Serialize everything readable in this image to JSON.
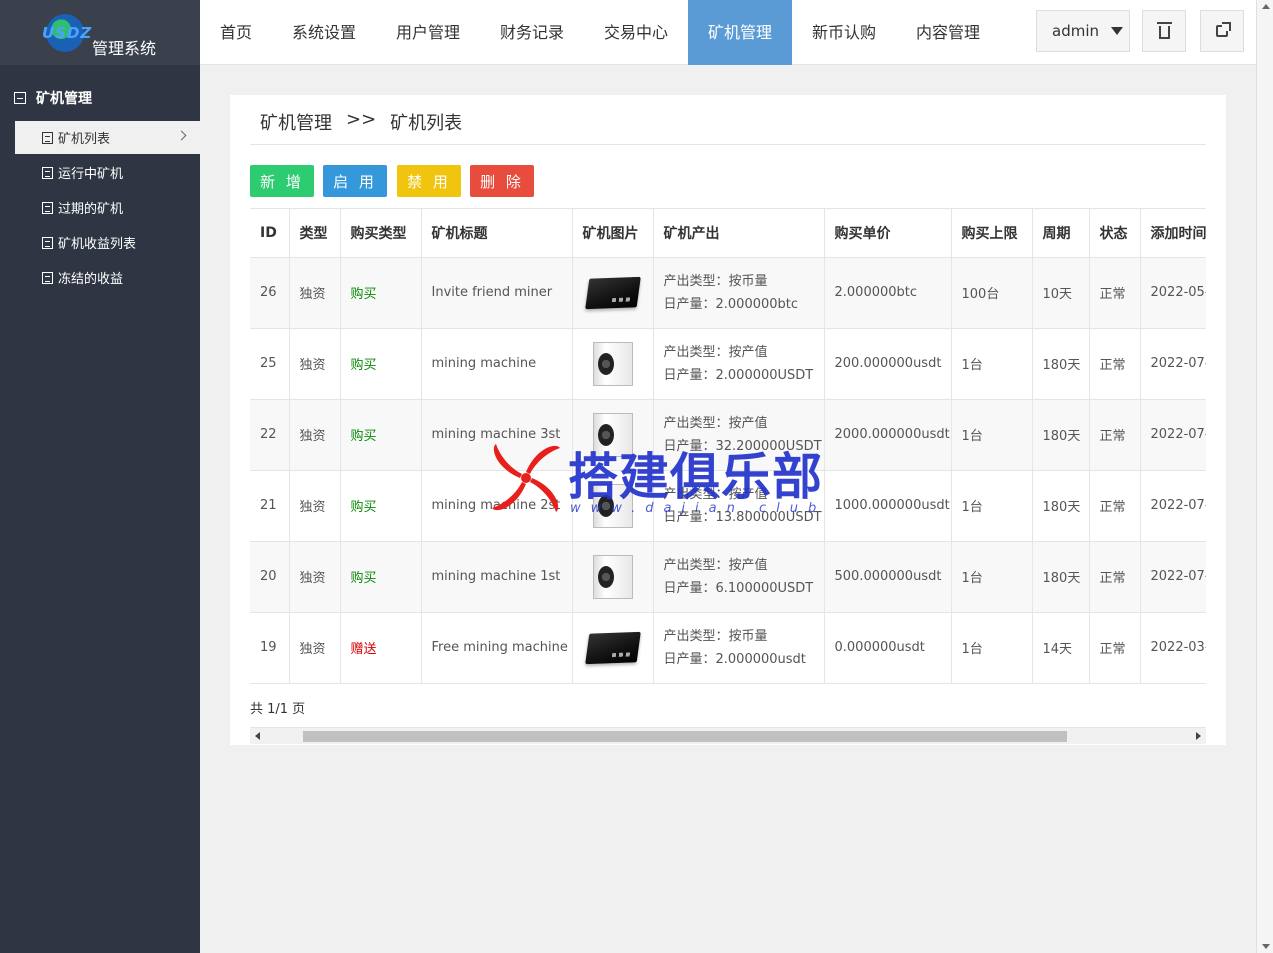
{
  "logo": {
    "brand": "USDZ",
    "system_name": "管理系统"
  },
  "sidebar": {
    "group_title": "矿机管理",
    "items": [
      {
        "label": "矿机列表",
        "active": true
      },
      {
        "label": "运行中矿机"
      },
      {
        "label": "过期的矿机"
      },
      {
        "label": "矿机收益列表"
      },
      {
        "label": "冻结的收益"
      }
    ]
  },
  "topnav": {
    "tabs": [
      {
        "label": "首页"
      },
      {
        "label": "系统设置"
      },
      {
        "label": "用户管理"
      },
      {
        "label": "财务记录"
      },
      {
        "label": "交易中心"
      },
      {
        "label": "矿机管理",
        "active": true
      },
      {
        "label": "新币认购"
      },
      {
        "label": "内容管理"
      }
    ],
    "user": "admin",
    "icons": [
      "trash-icon",
      "logout-icon"
    ]
  },
  "breadcrumb": {
    "section": "矿机管理",
    "separator": ">>",
    "page": "矿机列表"
  },
  "actions": {
    "add": {
      "label": "新 增",
      "color": "#2ecc71"
    },
    "enable": {
      "label": "启 用",
      "color": "#3498db"
    },
    "disable": {
      "label": "禁 用",
      "color": "#f1c40f"
    },
    "delete": {
      "label": "删 除",
      "color": "#e74c3c"
    }
  },
  "table": {
    "headers": [
      "ID",
      "类型",
      "购买类型",
      "矿机标题",
      "矿机图片",
      "矿机产出",
      "购买单价",
      "购买上限",
      "周期",
      "状态",
      "添加时间"
    ],
    "rows": [
      {
        "id": "26",
        "type": "独资",
        "buy_type": "购买",
        "title": "Invite friend miner",
        "image": "black-miner",
        "output_type": "产出类型：按币量",
        "daily": "日产量：2.000000btc",
        "price": "2.000000btc",
        "limit": "100台",
        "cycle": "10天",
        "status": "正常",
        "time": "2022-05-"
      },
      {
        "id": "25",
        "type": "独资",
        "buy_type": "购买",
        "title": "mining machine",
        "image": "white-miner",
        "output_type": "产出类型：按产值",
        "daily": "日产量：2.000000USDT",
        "price": "200.000000usdt",
        "limit": "1台",
        "cycle": "180天",
        "status": "正常",
        "time": "2022-07-"
      },
      {
        "id": "22",
        "type": "独资",
        "buy_type": "购买",
        "title": "mining machine 3st",
        "image": "white-miner",
        "output_type": "产出类型：按产值",
        "daily": "日产量：32.200000USDT",
        "price": "2000.000000usdt",
        "limit": "1台",
        "cycle": "180天",
        "status": "正常",
        "time": "2022-07-"
      },
      {
        "id": "21",
        "type": "独资",
        "buy_type": "购买",
        "title": "mining machine 2st",
        "image": "white-miner",
        "output_type": "产出类型：按产值",
        "daily": "日产量：13.800000USDT",
        "price": "1000.000000usdt",
        "limit": "1台",
        "cycle": "180天",
        "status": "正常",
        "time": "2022-07-"
      },
      {
        "id": "20",
        "type": "独资",
        "buy_type": "购买",
        "title": "mining machine 1st",
        "image": "white-miner",
        "output_type": "产出类型：按产值",
        "daily": "日产量：6.100000USDT",
        "price": "500.000000usdt",
        "limit": "1台",
        "cycle": "180天",
        "status": "正常",
        "time": "2022-07-"
      },
      {
        "id": "19",
        "type": "独资",
        "buy_type": "赠送",
        "title": "Free mining machine",
        "image": "black-miner",
        "output_type": "产出类型：按币量",
        "daily": "日产量：2.000000usdt",
        "price": "0.000000usdt",
        "limit": "1台",
        "cycle": "14天",
        "status": "正常",
        "time": "2022-03-"
      }
    ]
  },
  "pager": {
    "text": "共 1/1 页"
  },
  "watermark": {
    "text": "搭建俱乐部",
    "url": "www.dajian.club"
  }
}
